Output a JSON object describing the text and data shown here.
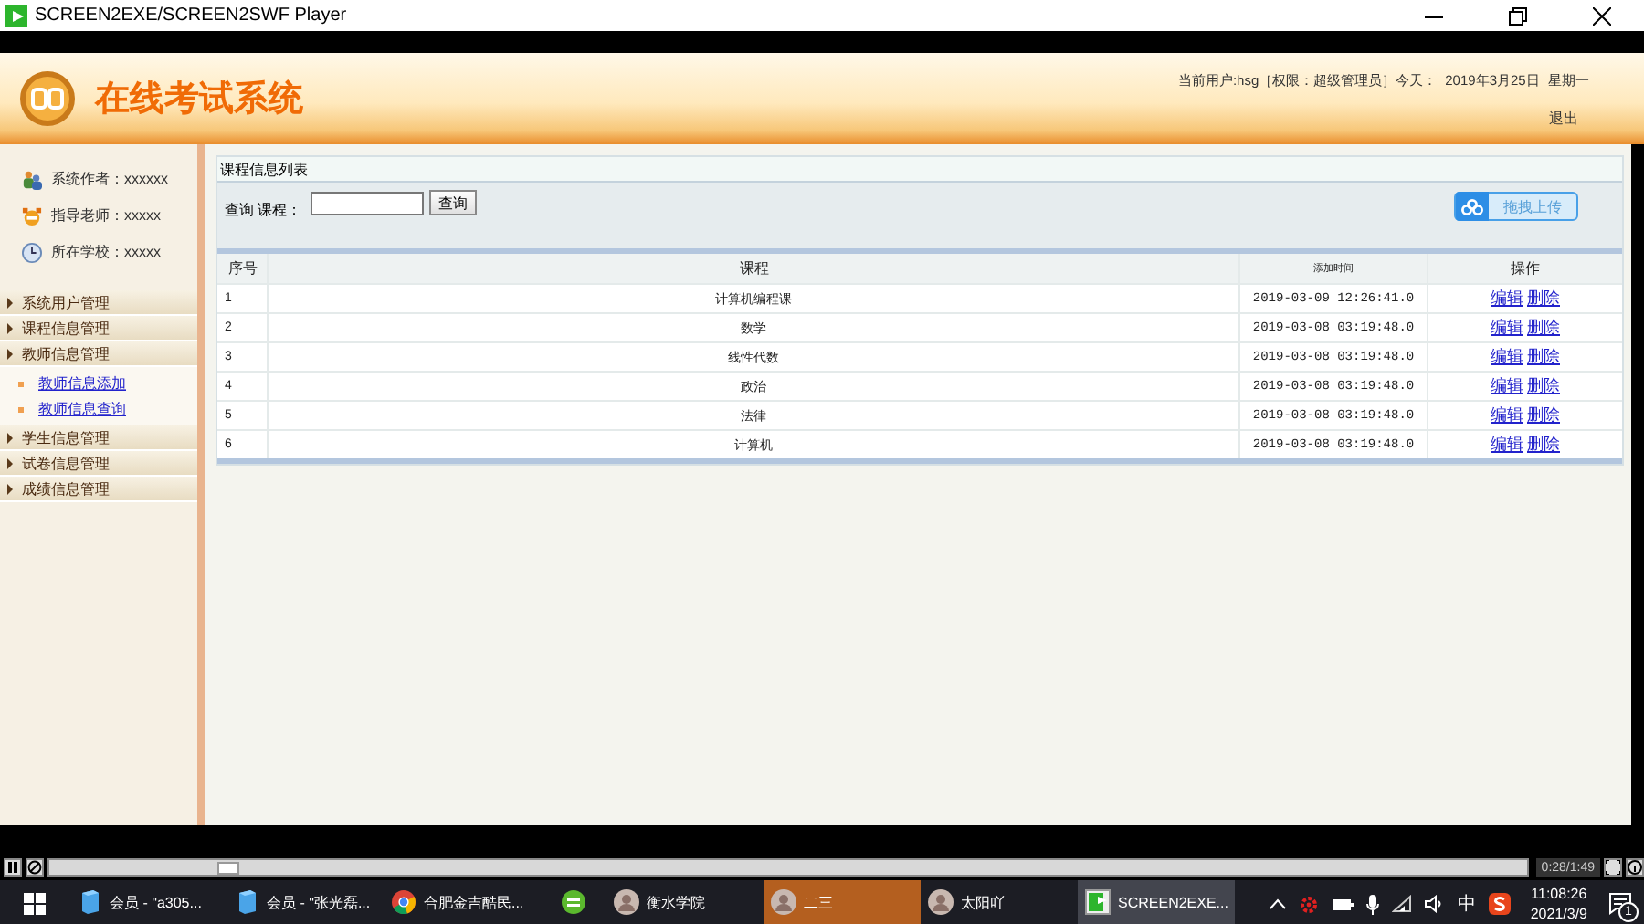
{
  "window": {
    "title": "SCREEN2EXE/SCREEN2SWF Player"
  },
  "header": {
    "app_title": "在线考试系统",
    "user": "当前用户:hsg［权限：超级管理员］今天：",
    "date": "2019年3月25日",
    "weekday": "星期一",
    "logout": "退出"
  },
  "sidebar": {
    "info": [
      {
        "kind": "author",
        "text": "系统作者：xxxxxx"
      },
      {
        "kind": "teacher",
        "text": "指导老师：xxxxx"
      },
      {
        "kind": "school",
        "text": "所在学校：xxxxx"
      }
    ],
    "menu": [
      {
        "label": "系统用户管理"
      },
      {
        "label": "课程信息管理"
      },
      {
        "label": "教师信息管理",
        "children": [
          {
            "label": "教师信息添加"
          },
          {
            "label": "教师信息查询"
          }
        ]
      },
      {
        "label": "学生信息管理"
      },
      {
        "label": "试卷信息管理"
      },
      {
        "label": "成绩信息管理"
      }
    ]
  },
  "panel": {
    "title": "课程信息列表",
    "search_label": "查询 课程：",
    "search_button": "查询",
    "upload_button": "拖拽上传"
  },
  "table": {
    "columns": [
      "序号",
      "课程",
      "添加时间",
      "操作"
    ],
    "rows": [
      {
        "cells": [
          "1",
          "计算机编程课",
          "2019-03-09 12:26:41.0"
        ],
        "actions": [
          "编辑",
          "删除"
        ]
      },
      {
        "cells": [
          "2",
          "数学",
          "2019-03-08 03:19:48.0"
        ],
        "actions": [
          "编辑",
          "删除"
        ]
      },
      {
        "cells": [
          "3",
          "线性代数",
          "2019-03-08 03:19:48.0"
        ],
        "actions": [
          "编辑",
          "删除"
        ]
      },
      {
        "cells": [
          "4",
          "政治",
          "2019-03-08 03:19:48.0"
        ],
        "actions": [
          "编辑",
          "删除"
        ]
      },
      {
        "cells": [
          "5",
          "法律",
          "2019-03-08 03:19:48.0"
        ],
        "actions": [
          "编辑",
          "删除"
        ]
      },
      {
        "cells": [
          "6",
          "计算机",
          "2019-03-08 03:19:48.0"
        ],
        "actions": [
          "编辑",
          "删除"
        ]
      }
    ]
  },
  "player": {
    "level": 0.12,
    "time": "0:28/1:49"
  },
  "taskbar": {
    "items": [
      {
        "kind": "doc",
        "label": "会员 - \"a305...",
        "selected": false,
        "attention": false
      },
      {
        "kind": "doc",
        "label": "会员 - \"张光磊...",
        "selected": false,
        "attention": false
      },
      {
        "kind": "browser",
        "label": "合肥金吉酷民...",
        "selected": false,
        "attention": false
      },
      {
        "kind": "green",
        "selected": false,
        "attention": false
      },
      {
        "kind": "avatar",
        "label": "衡水学院",
        "selected": false,
        "attention": false
      },
      {
        "kind": "avatar",
        "label": "二三",
        "selected": false,
        "attention": true
      },
      {
        "kind": "avatar",
        "label": "太阳吖",
        "selected": false,
        "attention": false
      },
      {
        "kind": "player",
        "label": "SCREEN2EXE...",
        "selected": true,
        "attention": false
      }
    ],
    "ime": "中",
    "time": "11:08:26",
    "date": "2021/3/9",
    "notifications": "1"
  }
}
